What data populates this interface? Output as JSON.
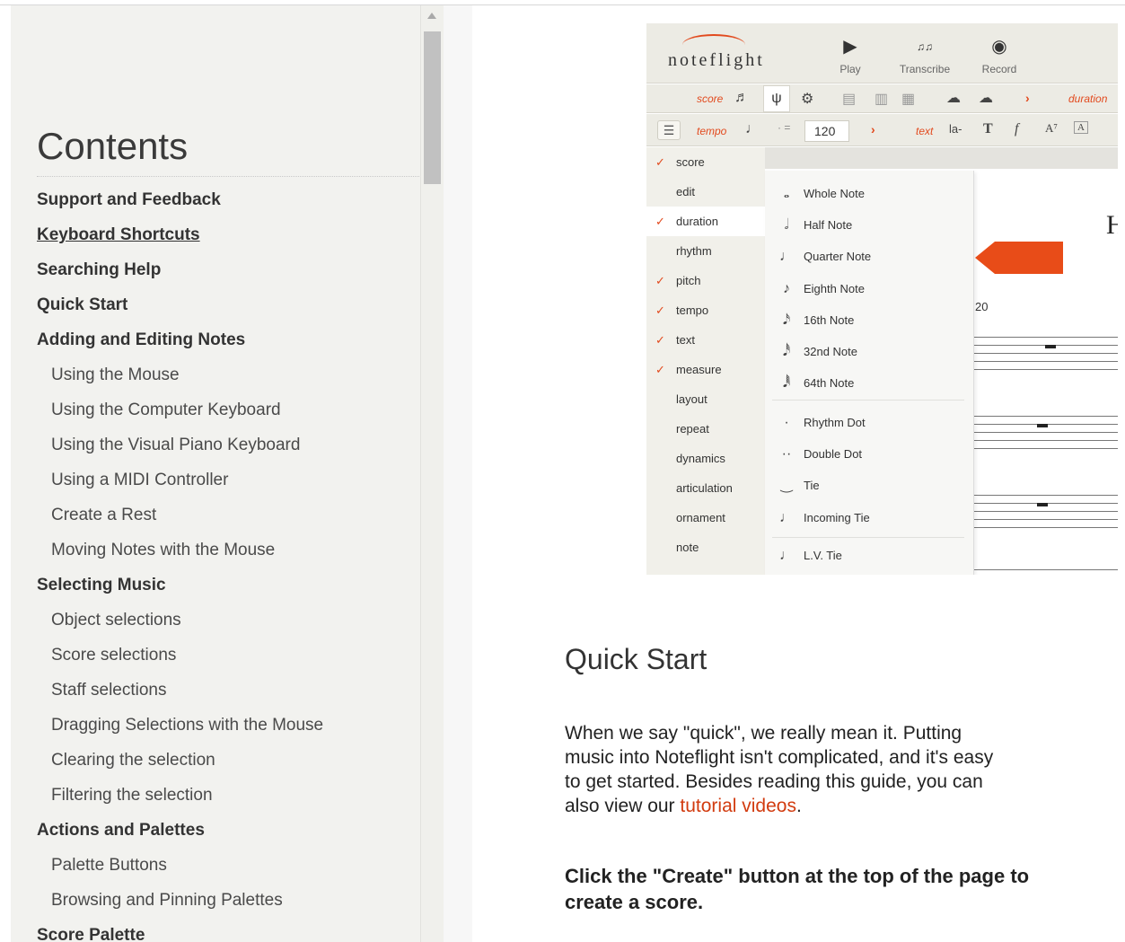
{
  "sidebar": {
    "title": "Contents",
    "items": [
      {
        "label": "Support and Feedback",
        "level": 1
      },
      {
        "label": "Keyboard Shortcuts",
        "level": 1
      },
      {
        "label": "Searching Help",
        "level": 1
      },
      {
        "label": "Quick Start",
        "level": 1
      },
      {
        "label": "Adding and Editing Notes",
        "level": 1
      },
      {
        "label": "Using the Mouse",
        "level": 2
      },
      {
        "label": "Using the Computer Keyboard",
        "level": 2
      },
      {
        "label": "Using the Visual Piano Keyboard",
        "level": 2
      },
      {
        "label": "Using a MIDI Controller",
        "level": 2
      },
      {
        "label": "Create a Rest",
        "level": 2
      },
      {
        "label": "Moving Notes with the Mouse",
        "level": 2
      },
      {
        "label": "Selecting Music",
        "level": 1
      },
      {
        "label": "Object selections",
        "level": 2
      },
      {
        "label": "Score selections",
        "level": 2
      },
      {
        "label": "Staff selections",
        "level": 2
      },
      {
        "label": "Dragging Selections with the Mouse",
        "level": 2
      },
      {
        "label": "Clearing the selection",
        "level": 2
      },
      {
        "label": "Filtering the selection",
        "level": 2
      },
      {
        "label": "Actions and Palettes",
        "level": 1
      },
      {
        "label": "Palette Buttons",
        "level": 2
      },
      {
        "label": "Browsing and Pinning Palettes",
        "level": 2
      },
      {
        "label": "Score Palette",
        "level": 1
      }
    ]
  },
  "noteflight": {
    "logo": "noteflight",
    "toolbar": {
      "play": "Play",
      "transcribe": "Transcribe",
      "record": "Record"
    },
    "row2": {
      "score_label": "score",
      "duration_label": "duration"
    },
    "row3": {
      "tempo_label": "tempo",
      "tempo_value": "120",
      "text_label": "text",
      "text_sample": "la-"
    },
    "categories": [
      {
        "label": "score",
        "checked": true
      },
      {
        "label": "edit",
        "checked": false
      },
      {
        "label": "duration",
        "checked": true
      },
      {
        "label": "rhythm",
        "checked": false
      },
      {
        "label": "pitch",
        "checked": true
      },
      {
        "label": "tempo",
        "checked": true
      },
      {
        "label": "text",
        "checked": true
      },
      {
        "label": "measure",
        "checked": true
      },
      {
        "label": "layout",
        "checked": false
      },
      {
        "label": "repeat",
        "checked": false
      },
      {
        "label": "dynamics",
        "checked": false
      },
      {
        "label": "articulation",
        "checked": false
      },
      {
        "label": "ornament",
        "checked": false
      },
      {
        "label": "note",
        "checked": false
      }
    ],
    "duration_menu": [
      {
        "label": "Whole Note",
        "icon": "𝅝"
      },
      {
        "label": "Half Note",
        "icon": "𝅗𝅥"
      },
      {
        "label": "Quarter Note",
        "icon": "♩"
      },
      {
        "label": "Eighth Note",
        "icon": "♪"
      },
      {
        "label": "16th Note",
        "icon": "𝅘𝅥𝅯"
      },
      {
        "label": "32nd Note",
        "icon": "𝅘𝅥𝅰"
      },
      {
        "label": "64th Note",
        "icon": "𝅘𝅥𝅱"
      },
      {
        "label": "Rhythm Dot",
        "icon": "·"
      },
      {
        "label": "Double Dot",
        "icon": "··"
      },
      {
        "label": "Tie",
        "icon": "‿"
      },
      {
        "label": "Incoming Tie",
        "icon": "♩"
      },
      {
        "label": "L.V. Tie",
        "icon": "♩"
      }
    ],
    "score_letter": "H",
    "tempo_fragment": "20",
    "accent_color": "#e24a1e"
  },
  "article": {
    "heading": "Quick Start",
    "para_before_link": "When we say \"quick\", we really mean it. Putting music into Noteflight isn't complicated, and it's easy to get started. Besides reading this guide, you can also view our ",
    "link": "tutorial videos",
    "para_after_link": ".",
    "bold_instruction": "Click the \"Create\" button at the top of the page to create a score."
  }
}
